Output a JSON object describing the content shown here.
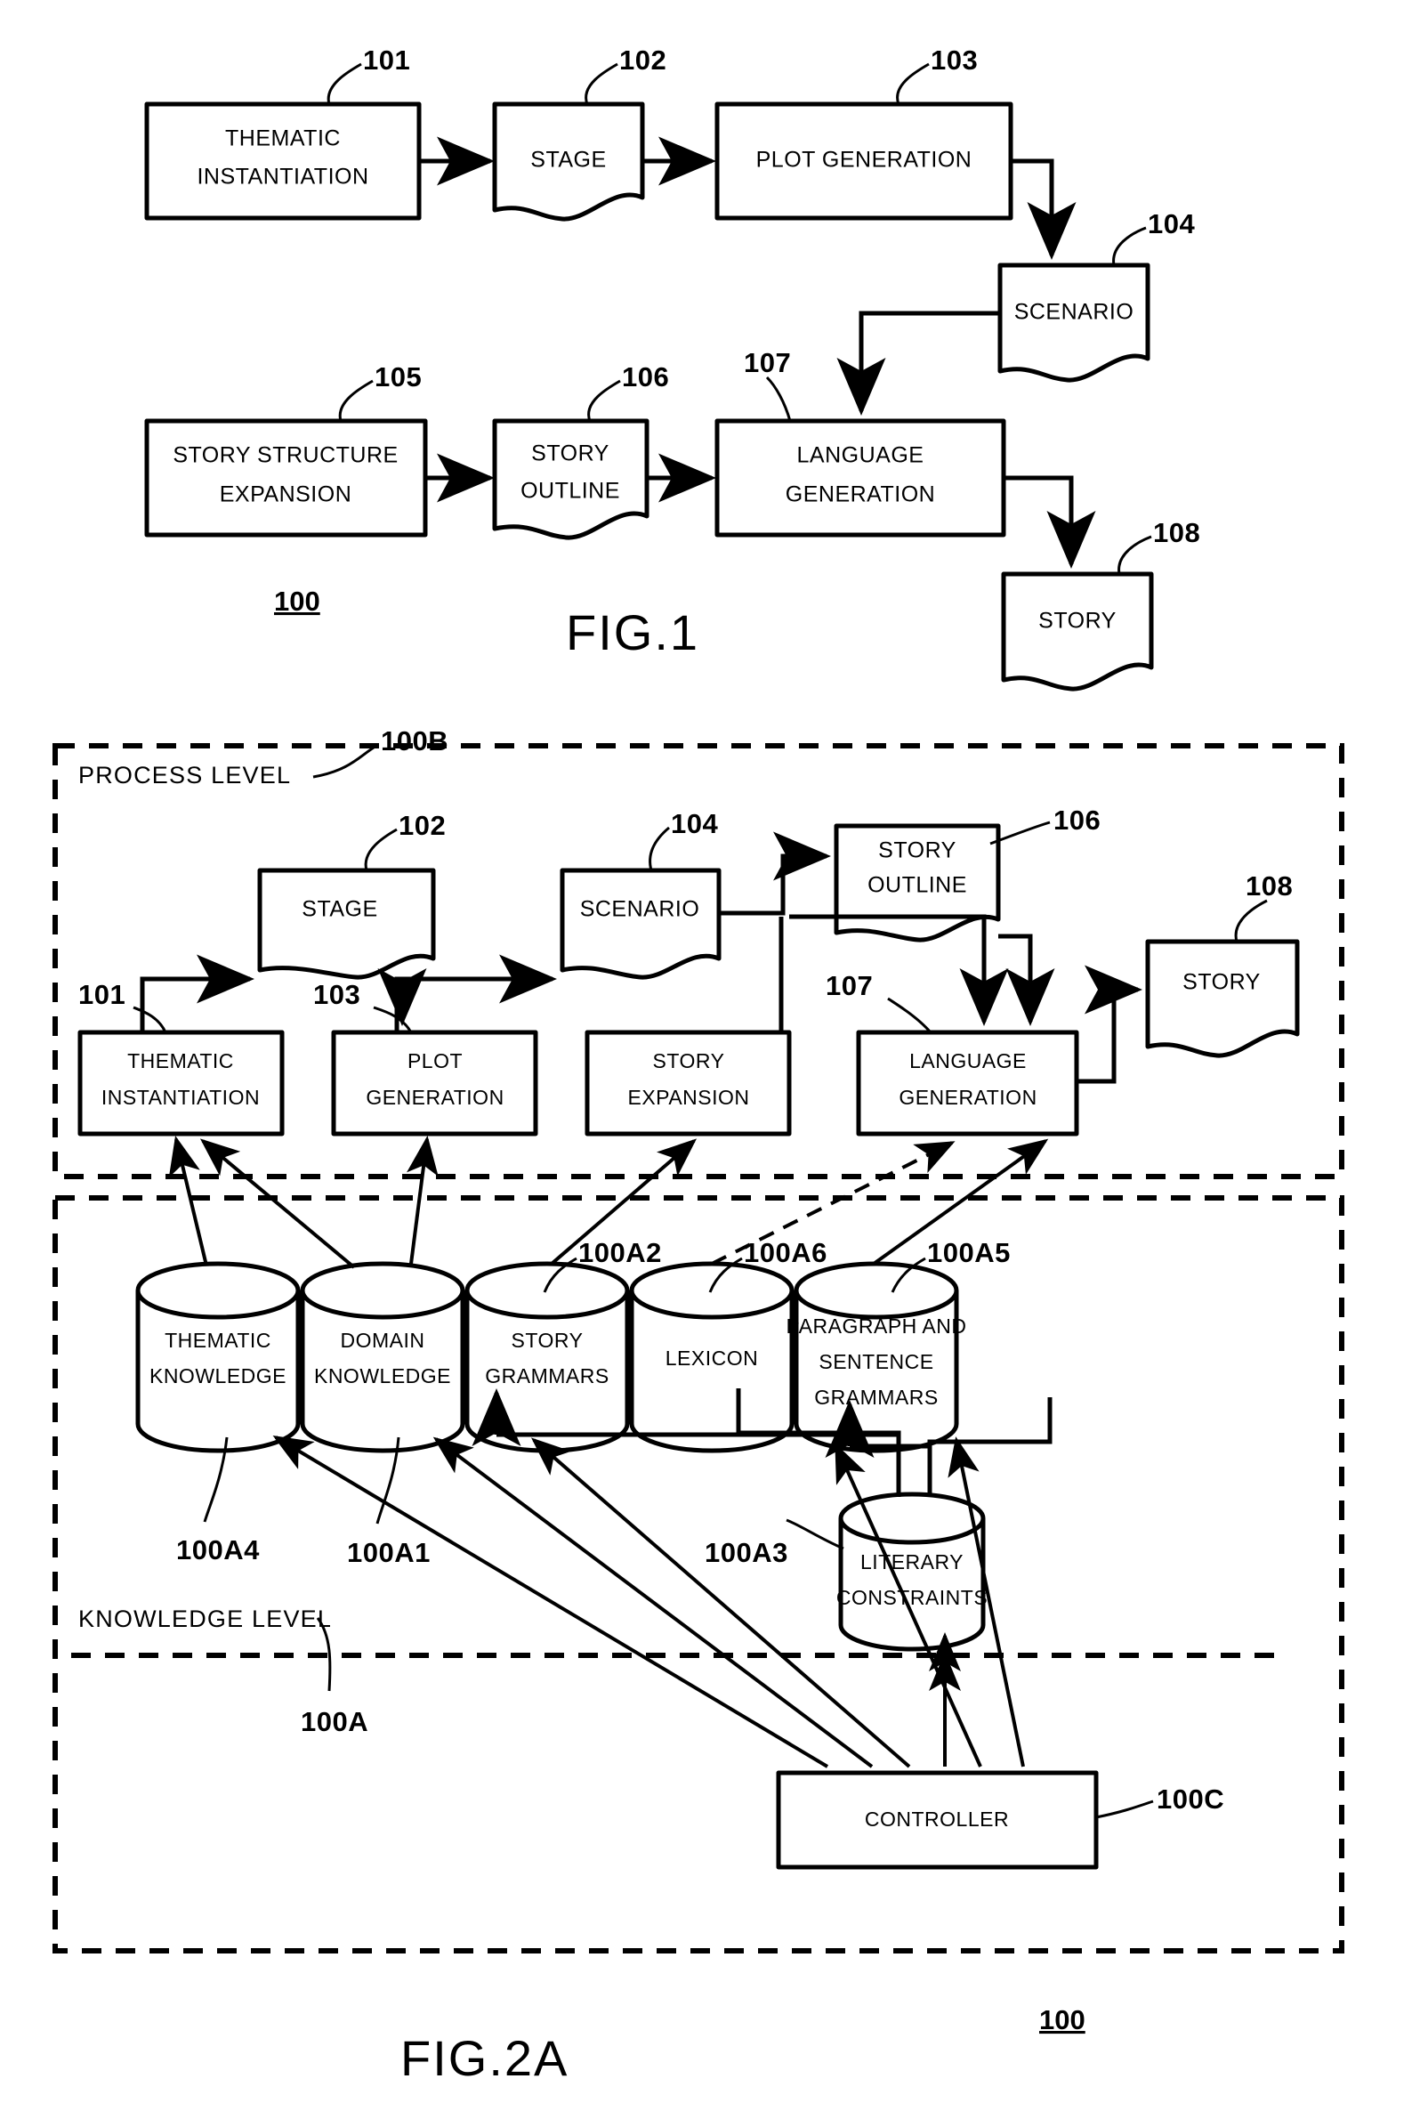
{
  "figure1": {
    "caption": "FIG.1",
    "system_ref": "100",
    "nodes": [
      {
        "id": "101",
        "label_lines": [
          "THEMATIC",
          "INSTANTIATION"
        ],
        "ref": "101",
        "shape": "rect"
      },
      {
        "id": "102",
        "label_lines": [
          "STAGE"
        ],
        "ref": "102",
        "shape": "document"
      },
      {
        "id": "103",
        "label_lines": [
          "PLOT  GENERATION"
        ],
        "ref": "103",
        "shape": "rect"
      },
      {
        "id": "104",
        "label_lines": [
          "SCENARIO"
        ],
        "ref": "104",
        "shape": "document"
      },
      {
        "id": "105",
        "label_lines": [
          "STORY STRUCTURE",
          "EXPANSION"
        ],
        "ref": "105",
        "shape": "rect"
      },
      {
        "id": "106",
        "label_lines": [
          "STORY",
          "OUTLINE"
        ],
        "ref": "106",
        "shape": "document"
      },
      {
        "id": "107",
        "label_lines": [
          "LANGUAGE",
          "GENERATION"
        ],
        "ref": "107",
        "shape": "rect"
      },
      {
        "id": "108",
        "label_lines": [
          "STORY"
        ],
        "ref": "108",
        "shape": "document"
      }
    ]
  },
  "figure2a": {
    "caption": "FIG.2A",
    "system_ref": "100",
    "process_level": {
      "title": "PROCESS LEVEL",
      "ref": "100B",
      "nodes": [
        {
          "id": "p101",
          "label_lines": [
            "THEMATIC",
            "INSTANTIATION"
          ],
          "ref": "101",
          "shape": "rect"
        },
        {
          "id": "p102",
          "label_lines": [
            "STAGE"
          ],
          "ref": "102",
          "shape": "document"
        },
        {
          "id": "p103",
          "label_lines": [
            "PLOT",
            "GENERATION"
          ],
          "ref": "103",
          "shape": "rect"
        },
        {
          "id": "p104",
          "label_lines": [
            "SCENARIO"
          ],
          "ref": "104",
          "shape": "document"
        },
        {
          "id": "p105",
          "label_lines": [
            "STORY",
            "EXPANSION"
          ],
          "ref": "",
          "shape": "rect"
        },
        {
          "id": "p106",
          "label_lines": [
            "STORY",
            "OUTLINE"
          ],
          "ref": "106",
          "shape": "document"
        },
        {
          "id": "p107",
          "label_lines": [
            "LANGUAGE",
            "GENERATION"
          ],
          "ref": "107",
          "shape": "rect"
        },
        {
          "id": "p108",
          "label_lines": [
            "STORY"
          ],
          "ref": "108",
          "shape": "document"
        }
      ]
    },
    "knowledge_level": {
      "title": "KNOWLEDGE LEVEL",
      "ref": "100A",
      "stores": [
        {
          "id": "k1",
          "label_lines": [
            "THEMATIC",
            "KNOWLEDGE"
          ],
          "ref": "100A4"
        },
        {
          "id": "k2",
          "label_lines": [
            "DOMAIN",
            "KNOWLEDGE"
          ],
          "ref": "100A1"
        },
        {
          "id": "k3",
          "label_lines": [
            "STORY",
            "GRAMMARS"
          ],
          "ref": "100A2"
        },
        {
          "id": "k4",
          "label_lines": [
            "LEXICON"
          ],
          "ref": "100A6"
        },
        {
          "id": "k5",
          "label_lines": [
            "PARAGRAPH AND",
            "SENTENCE",
            "GRAMMARS"
          ],
          "ref": "100A5"
        },
        {
          "id": "k6",
          "label_lines": [
            "LITERARY",
            "CONSTRAINTS"
          ],
          "ref": "100A3"
        }
      ]
    },
    "controller": {
      "label": "CONTROLLER",
      "ref": "100C"
    }
  }
}
